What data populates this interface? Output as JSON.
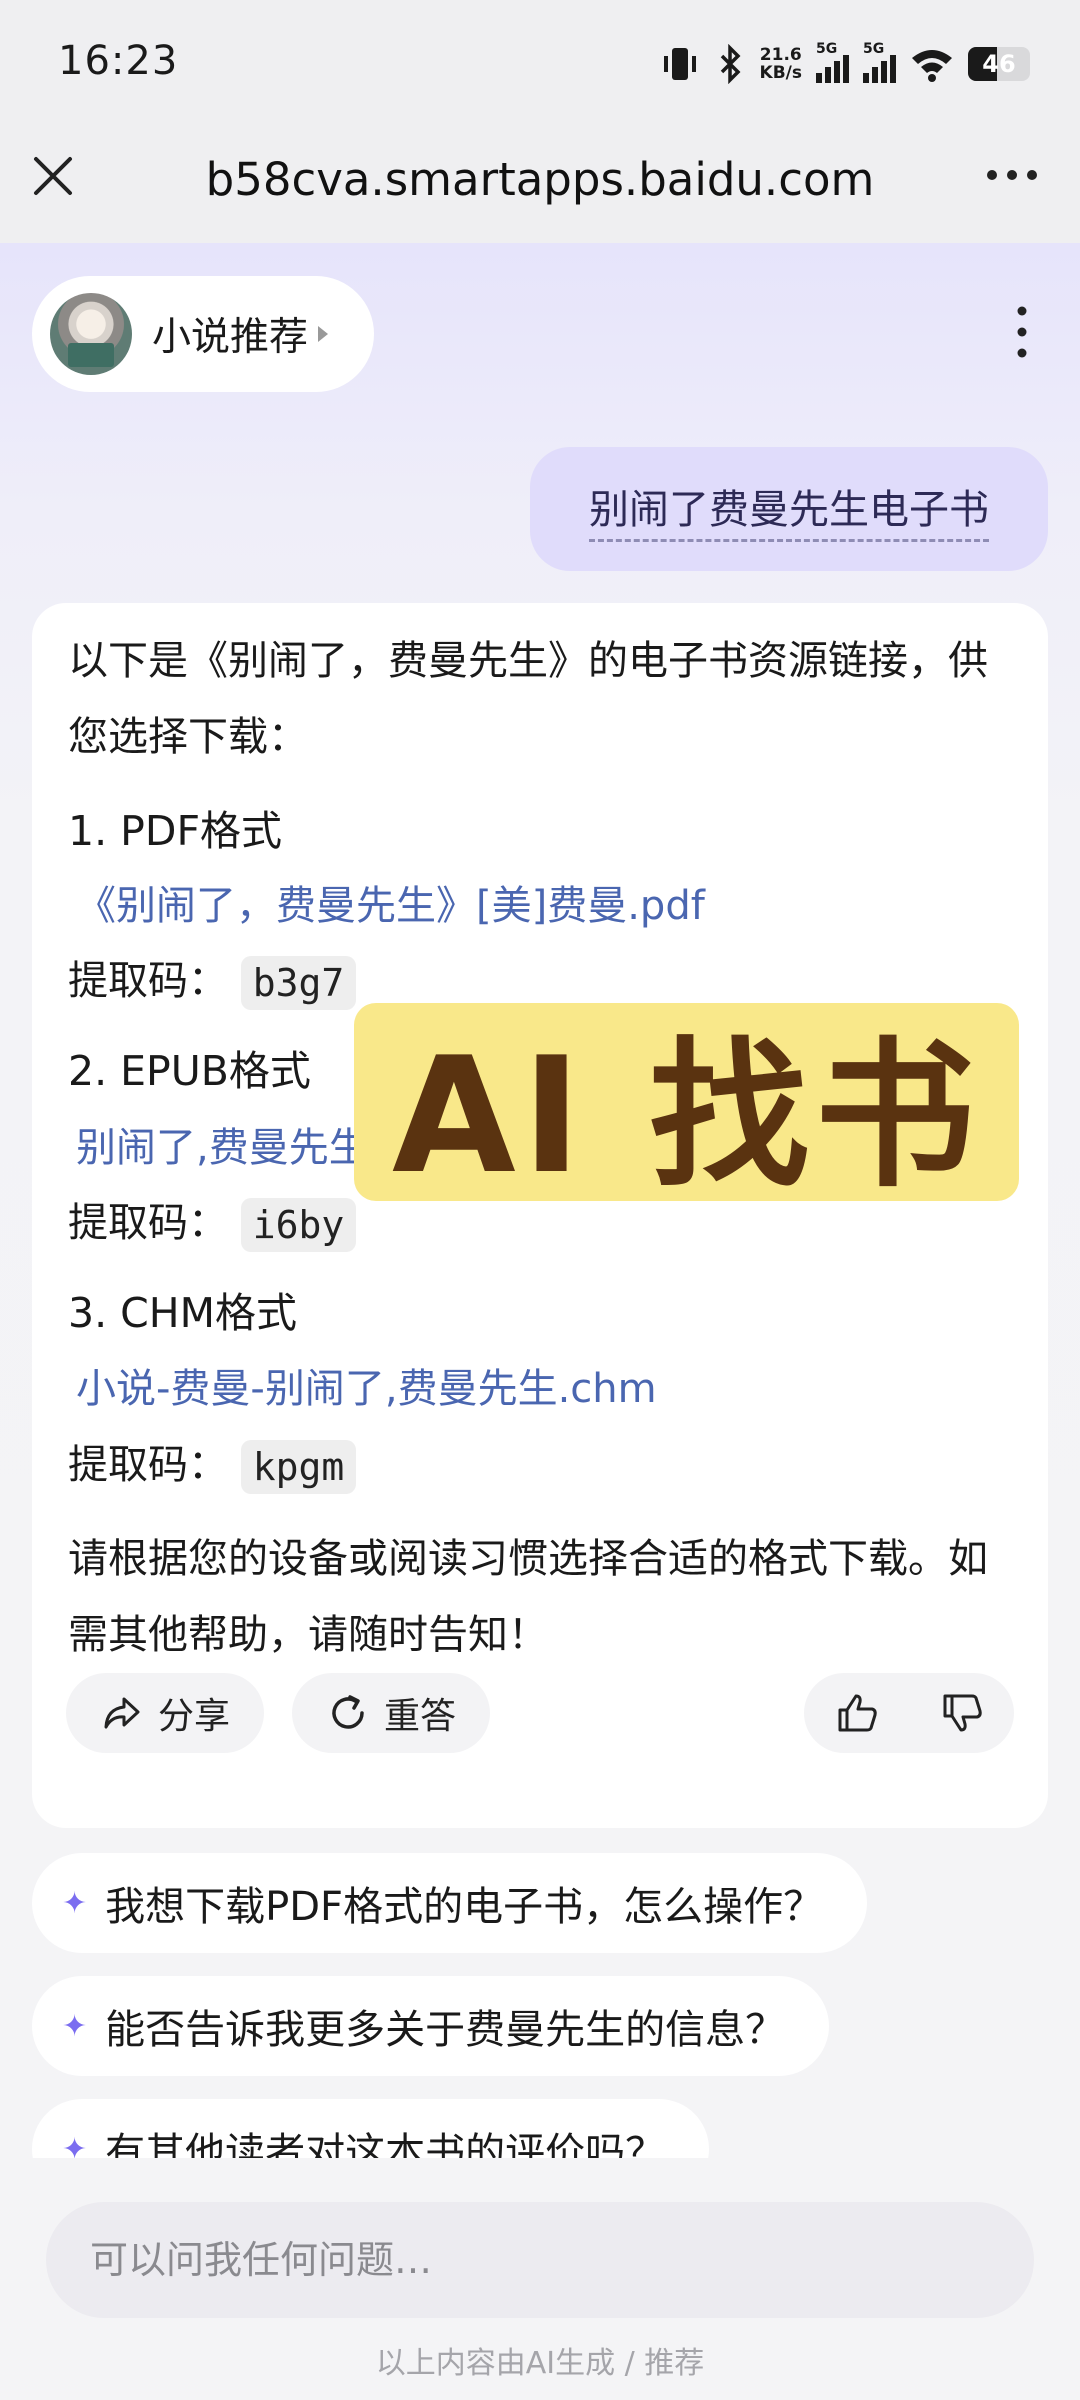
{
  "status_bar": {
    "time": "16:23",
    "speed_value": "21.6",
    "speed_unit": "KB/s",
    "sim1": "5G",
    "sim2": "5G",
    "battery": "46",
    "battery_level": 0.46
  },
  "url_bar": {
    "title": "b58cva.smartapps.baidu.com"
  },
  "agent": {
    "name": "小说推荐"
  },
  "user_message": "别闹了费曼先生电子书",
  "answer": {
    "intro": "以下是《别闹了，费曼先生》的电子书资源链接，供您选择下载：",
    "formats": [
      {
        "heading": "1. PDF格式",
        "link": "《别闹了，费曼先生》[美]费曼.pdf",
        "code_label": "提取码：",
        "code": "b3g7"
      },
      {
        "heading": "2. EPUB格式",
        "link": "别闹了,费曼先生",
        "code_label": "提取码：",
        "code": "i6by"
      },
      {
        "heading": "3. CHM格式",
        "link": "小说-费曼-别闹了,费曼先生.chm",
        "code_label": "提取码：",
        "code": "kpgm"
      }
    ],
    "closing": "请根据您的设备或阅读习惯选择合适的格式下载。如需其他帮助，请随时告知！",
    "share_label": "分享",
    "regen_label": "重答"
  },
  "overlay_banner": "AI 找书",
  "suggestions": [
    "我想下载PDF格式的电子书，怎么操作？",
    "能否告诉我更多关于费曼先生的信息？",
    "有其他读者对这本书的评价吗？"
  ],
  "input": {
    "placeholder": "可以问我任何问题…"
  },
  "disclaimer": "以上内容由AI生成 / 推荐",
  "colors": {
    "link": "#4a66b0",
    "banner": "#f9e88a",
    "user_bubble": "#e0dcfb",
    "spark": "#7b6df0"
  }
}
